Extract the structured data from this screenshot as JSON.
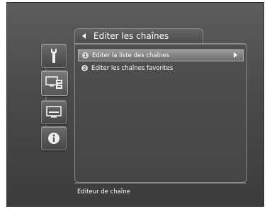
{
  "header": {
    "title": "Editer les chaînes",
    "back_icon": "arrow-left-icon"
  },
  "sidebar": {
    "items": [
      {
        "icon": "wrench-icon",
        "active": false
      },
      {
        "icon": "tv-channels-icon",
        "active": true
      },
      {
        "icon": "monitor-icon",
        "active": false
      },
      {
        "icon": "info-icon",
        "active": false
      }
    ]
  },
  "menu": {
    "items": [
      {
        "number": "1",
        "label": "Editer la liste des chaînes",
        "selected": true,
        "has_submenu": true
      },
      {
        "number": "2",
        "label": "Editer les chaînes favorites",
        "selected": false,
        "has_submenu": false
      }
    ]
  },
  "status": {
    "text": "Editeur de chaîne"
  },
  "colors": {
    "background": "#4a4a4a",
    "selected_row": "#8a8a8a",
    "text": "#ffffff"
  }
}
